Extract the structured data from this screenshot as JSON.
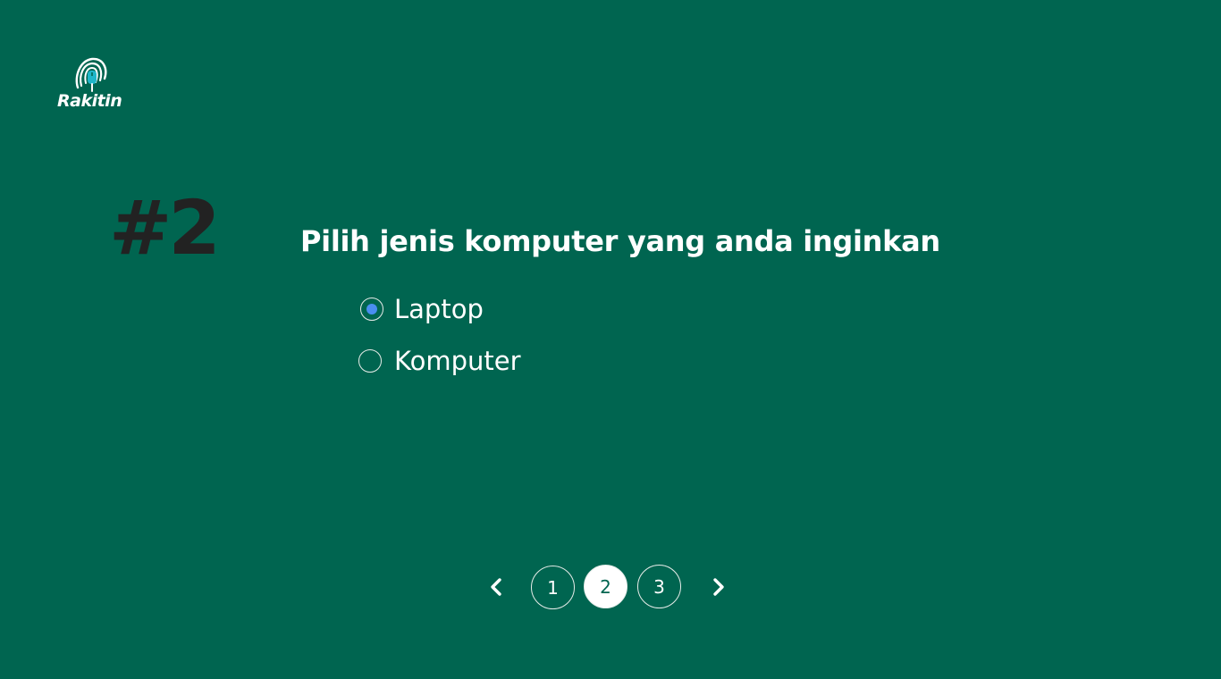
{
  "brand": {
    "name": "Rakitin"
  },
  "question": {
    "number": "#2",
    "title": "Pilih jenis komputer yang anda inginkan",
    "options": [
      {
        "label": "Laptop",
        "selected": true
      },
      {
        "label": "Komputer",
        "selected": false
      }
    ]
  },
  "pagination": {
    "pages": [
      "1",
      "2",
      "3"
    ],
    "current": "2",
    "prev_icon": "chevron-left-icon",
    "next_icon": "chevron-right-icon"
  },
  "colors": {
    "background": "#006550",
    "accent_dot": "#4a8ef0",
    "text": "#ffffff",
    "number": "#222222"
  }
}
